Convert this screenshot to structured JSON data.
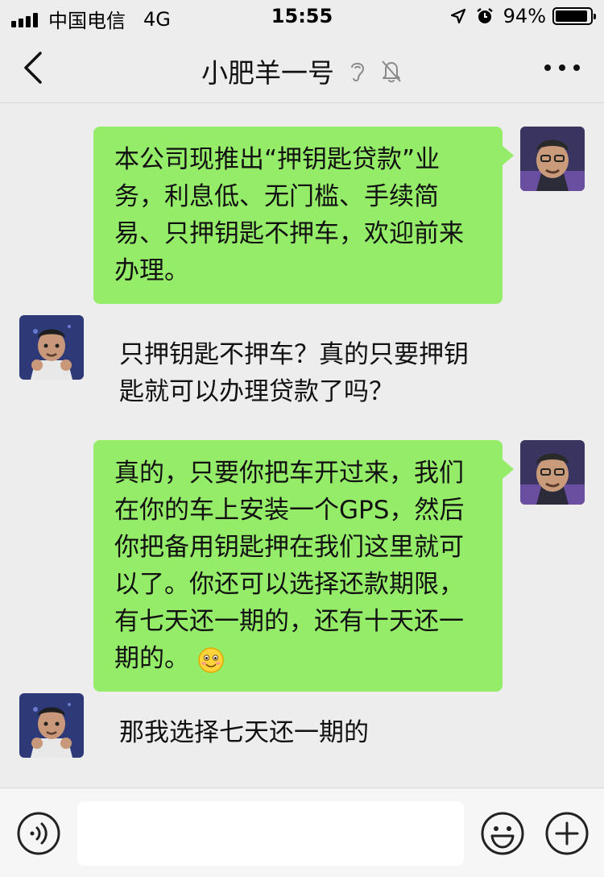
{
  "status_bar": {
    "carrier": "中国电信",
    "network": "4G",
    "time": "15:55",
    "battery": "94%",
    "battery_level": 0.94,
    "icons": [
      "signal-bars-icon",
      "location-arrow-icon",
      "alarm-clock-icon",
      "battery-icon"
    ]
  },
  "nav": {
    "title": "小肥羊一号",
    "icons": [
      "back-chevron-icon",
      "earpiece-icon",
      "mute-bell-icon",
      "more-dots-icon"
    ]
  },
  "messages": [
    {
      "direction": "out",
      "lines": [
        "本公司现推出“押钥匙贷款”业",
        "务，利息低、无门槛、手续简",
        "易、只押钥匙不押车，欢迎前来",
        "办理。"
      ]
    },
    {
      "direction": "in",
      "lines": [
        "只押钥匙不押车？真的只要押钥",
        "匙就可以办理贷款了吗？"
      ]
    },
    {
      "direction": "out",
      "lines": [
        "真的，只要你把车开过来，我们",
        "在你的车上安装一个GPS，然后",
        "你把备用钥匙押在我们这里就可",
        "以了。你还可以选择还款期限，",
        "有七天还一期的，还有十天还一",
        "期的。"
      ],
      "trailing_emoji": "smile-emoji-icon"
    },
    {
      "direction": "in",
      "lines": [
        "那我选择七天还一期的"
      ]
    }
  ],
  "input_bar": {
    "value": "",
    "icons": [
      "voice-icon",
      "emoji-face-icon",
      "plus-icon"
    ]
  },
  "colors": {
    "background": "#ededed",
    "outgoing_bubble": "#95ec69",
    "input_bar": "#f6f6f6"
  }
}
